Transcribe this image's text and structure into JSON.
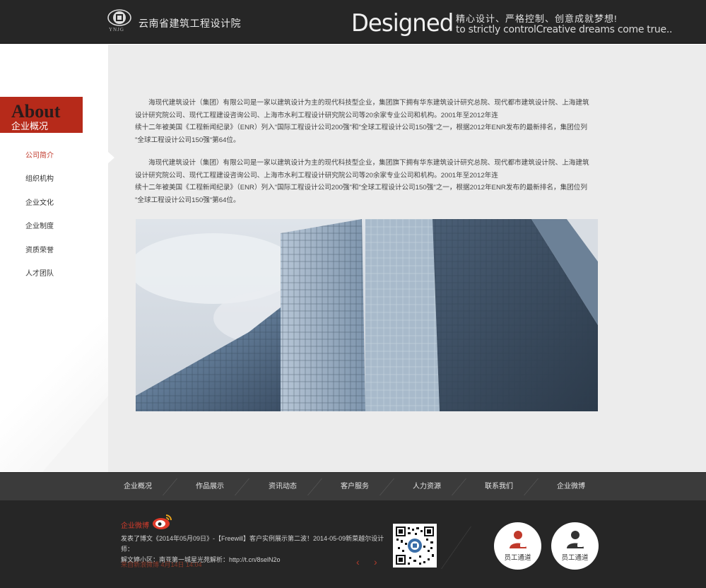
{
  "header": {
    "logo_sub": "YNJG",
    "company_name": "云南省建筑工程设计院",
    "slogan_big": "Designed",
    "slogan_cn": "精心设计、严格控制、创意成就梦想!",
    "slogan_en": "to strictly controlCreative dreams come true.."
  },
  "sidebar": {
    "badge_title": "About",
    "badge_subtitle": "企业概况",
    "items": [
      {
        "label": "公司简介",
        "active": true
      },
      {
        "label": "组织机构",
        "active": false
      },
      {
        "label": "企业文化",
        "active": false
      },
      {
        "label": "企业制度",
        "active": false
      },
      {
        "label": "资质荣誉",
        "active": false
      },
      {
        "label": "人才团队",
        "active": false
      }
    ]
  },
  "content": {
    "paragraph1": {
      "line1": "海现代建筑设计（集团）有限公司是一家以建筑设计为主的现代科技型企业，集团旗下拥有华东建筑设计研究总院、现代都市建筑设计院、上海建筑",
      "line2": "设计研究院公司、现代工程建设咨询公司、上海市水利工程设计研究院公司等20余家专业公司和机构。2001年至2012年连",
      "line3": "续十二年被美国《工程新闻纪录》（ENR）列入\"国际工程设计公司200强\"和\"全球工程设计公司150强\"之一，根据2012年ENR发布的最新排名，集团位列",
      "line4": "\"全球工程设计公司150强\"第64位。"
    },
    "paragraph2": {
      "line1": "海现代建筑设计（集团）有限公司是一家以建筑设计为主的现代科技型企业，集团旗下拥有华东建筑设计研究总院、现代都市建筑设计院、上海建筑",
      "line2": "设计研究院公司、现代工程建设咨询公司、上海市水利工程设计研究院公司等20余家专业公司和机构。2001年至2012年连",
      "line3": "续十二年被美国《工程新闻纪录》（ENR）列入\"国际工程设计公司200强\"和\"全球工程设计公司150强\"之一，根据2012年ENR发布的最新排名，集团位列",
      "line4": "\"全球工程设计公司150强\"第64位。"
    }
  },
  "footer_nav": {
    "items": [
      "企业概况",
      "作品展示",
      "资讯动态",
      "客户服务",
      "人力资源",
      "联系我们",
      "企业微博"
    ]
  },
  "footer": {
    "weibo_title": "企业微博",
    "weibo_post_line1": "发表了博文《2014年05月09日》-【Freewill】客户实例展示第二波！2014-05-09新菜越尔设计师：",
    "weibo_post_line2": "解文婷小区：南亚第一城星光苑解析：http://t.cn/8selN2o",
    "weibo_meta": "来自新浪微博  4月14日 14:04",
    "prev_arrow": "‹",
    "next_arrow": "›",
    "staff_buttons": [
      {
        "label": "员工通道",
        "color": "#c0392b"
      },
      {
        "label": "员工通道",
        "color": "#333333"
      }
    ]
  },
  "colors": {
    "accent_red": "#b62a1a",
    "header_bg": "#262626",
    "main_bg": "#ececec",
    "footnav_bg": "#3b3b3b"
  }
}
